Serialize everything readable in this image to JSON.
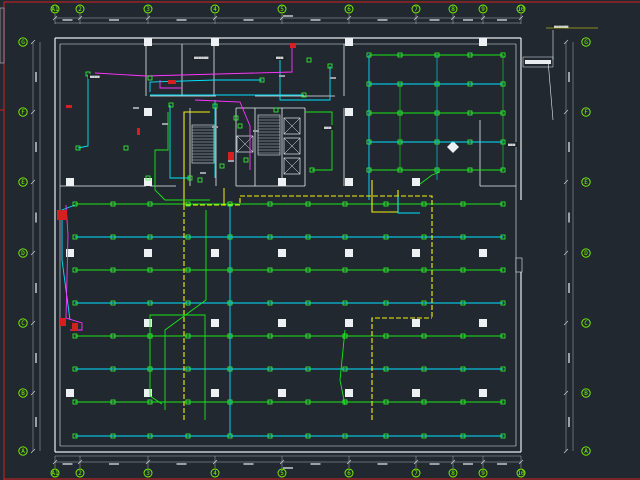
{
  "drawing": {
    "colors": {
      "background": "#212830",
      "wall": "#e8ecef",
      "axis": "#7cfc00",
      "pipe_cyan": "#00e5ff",
      "pipe_green": "#19e619",
      "pipe_yellow": "#f2f20d",
      "pipe_magenta": "#ff33ff",
      "sprinkler": "#33ff33",
      "frame_red": "#d42020"
    },
    "columns": [
      "A1",
      "2",
      "3",
      "4",
      "5",
      "6",
      "7",
      "8",
      "9",
      "10"
    ],
    "rows": [
      "G",
      "F",
      "E",
      "D",
      "C",
      "B",
      "A"
    ],
    "callouts": [
      "■■■■",
      "■■■■■■",
      "■■■"
    ]
  }
}
